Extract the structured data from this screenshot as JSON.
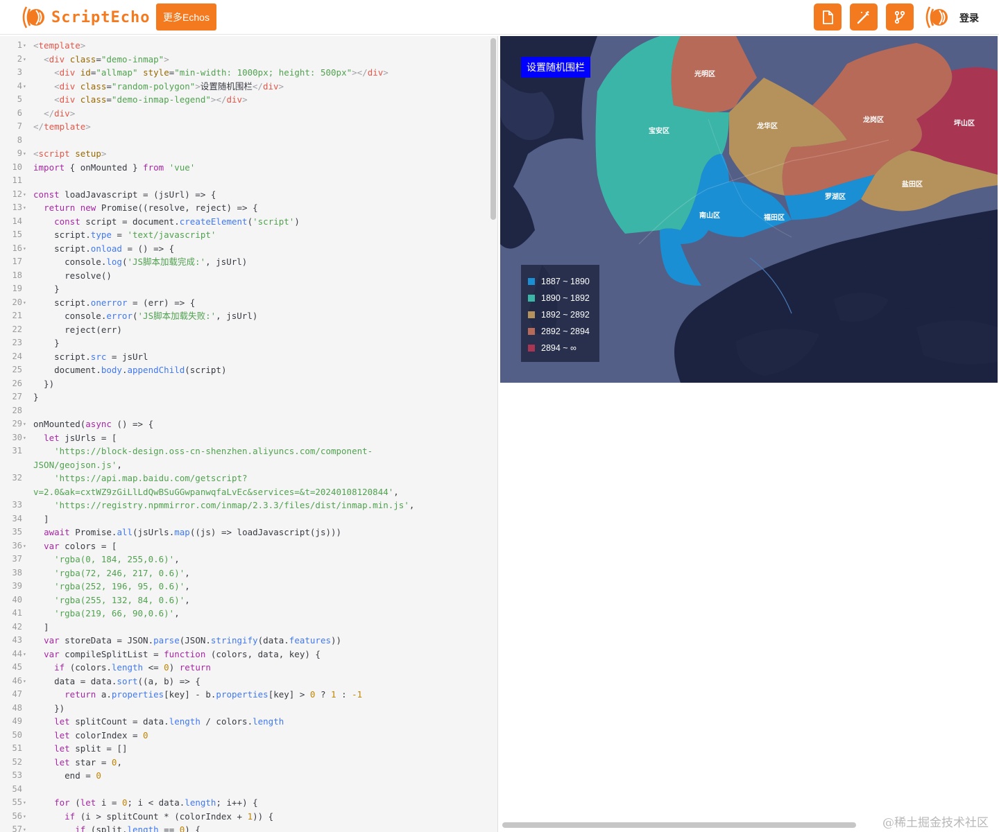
{
  "header": {
    "logo_text": "ScriptEcho",
    "more_button": "更多Echos",
    "login_text": "登录",
    "accent_color": "#f47a20",
    "tools": [
      {
        "name": "file-icon"
      },
      {
        "name": "magic-wand-icon"
      },
      {
        "name": "branch-icon"
      }
    ]
  },
  "editor": {
    "lines": [
      {
        "n": "1",
        "f": true,
        "html": "<span class='c-punc'>&lt;</span><span class='c-tag'>template</span><span class='c-punc'>&gt;</span>"
      },
      {
        "n": "2",
        "f": true,
        "html": "  <span class='c-punc'>&lt;</span><span class='c-tag'>div</span> <span class='c-attr'>class</span>=<span class='c-str'>\"demo-inmap\"</span><span class='c-punc'>&gt;</span>"
      },
      {
        "n": "3",
        "f": false,
        "html": "    <span class='c-punc'>&lt;</span><span class='c-tag'>div</span> <span class='c-attr'>id</span>=<span class='c-str'>\"allmap\"</span> <span class='c-attr'>style</span>=<span class='c-str'>\"min-width: 1000px; height: 500px\"</span><span class='c-punc'>&gt;&lt;/</span><span class='c-tag'>div</span><span class='c-punc'>&gt;</span>"
      },
      {
        "n": "4",
        "f": true,
        "html": "    <span class='c-punc'>&lt;</span><span class='c-tag'>div</span> <span class='c-attr'>class</span>=<span class='c-str'>\"random-polygon\"</span><span class='c-punc'>&gt;</span>设置随机围栏<span class='c-punc'>&lt;/</span><span class='c-tag'>div</span><span class='c-punc'>&gt;</span>"
      },
      {
        "n": "5",
        "f": false,
        "html": "    <span class='c-punc'>&lt;</span><span class='c-tag'>div</span> <span class='c-attr'>class</span>=<span class='c-str'>\"demo-inmap-legend\"</span><span class='c-punc'>&gt;&lt;/</span><span class='c-tag'>div</span><span class='c-punc'>&gt;</span>"
      },
      {
        "n": "6",
        "f": false,
        "html": "  <span class='c-punc'>&lt;/</span><span class='c-tag'>div</span><span class='c-punc'>&gt;</span>"
      },
      {
        "n": "7",
        "f": false,
        "html": "<span class='c-punc'>&lt;/</span><span class='c-tag'>template</span><span class='c-punc'>&gt;</span>"
      },
      {
        "n": "8",
        "f": false,
        "html": ""
      },
      {
        "n": "9",
        "f": true,
        "html": "<span class='c-punc'>&lt;</span><span class='c-tag'>script</span> <span class='c-attr'>setup</span><span class='c-punc'>&gt;</span>"
      },
      {
        "n": "10",
        "f": false,
        "html": "<span class='c-kw'>import</span> { onMounted } <span class='c-kw'>from</span> <span class='c-str'>'vue'</span>"
      },
      {
        "n": "11",
        "f": false,
        "html": ""
      },
      {
        "n": "12",
        "f": true,
        "html": "<span class='c-kw'>const</span> loadJavascript = (jsUrl) =&gt; {"
      },
      {
        "n": "13",
        "f": true,
        "html": "  <span class='c-kw'>return</span> <span class='c-kw'>new</span> Promise((resolve, reject) =&gt; {"
      },
      {
        "n": "14",
        "f": false,
        "html": "    <span class='c-kw'>const</span> script = document.<span class='c-fn'>createElement</span>(<span class='c-str'>'script'</span>)"
      },
      {
        "n": "15",
        "f": false,
        "html": "    script.<span class='c-prop'>type</span> = <span class='c-str'>'text/javascript'</span>"
      },
      {
        "n": "16",
        "f": true,
        "html": "    script.<span class='c-prop'>onload</span> = () =&gt; {"
      },
      {
        "n": "17",
        "f": false,
        "html": "      console.<span class='c-fn'>log</span>(<span class='c-str'>'JS脚本加载完成:'</span>, jsUrl)"
      },
      {
        "n": "18",
        "f": false,
        "html": "      resolve()"
      },
      {
        "n": "19",
        "f": false,
        "html": "    }"
      },
      {
        "n": "20",
        "f": true,
        "html": "    script.<span class='c-prop'>onerror</span> = (err) =&gt; {"
      },
      {
        "n": "21",
        "f": false,
        "html": "      console.<span class='c-fn'>error</span>(<span class='c-str'>'JS脚本加载失败:'</span>, jsUrl)"
      },
      {
        "n": "22",
        "f": false,
        "html": "      reject(err)"
      },
      {
        "n": "23",
        "f": false,
        "html": "    }"
      },
      {
        "n": "24",
        "f": false,
        "html": "    script.<span class='c-prop'>src</span> = jsUrl"
      },
      {
        "n": "25",
        "f": false,
        "html": "    document.<span class='c-prop'>body</span>.<span class='c-fn'>appendChild</span>(script)"
      },
      {
        "n": "26",
        "f": false,
        "html": "  })"
      },
      {
        "n": "27",
        "f": false,
        "html": "}"
      },
      {
        "n": "28",
        "f": false,
        "html": ""
      },
      {
        "n": "29",
        "f": true,
        "html": "onMounted(<span class='c-kw'>async</span> () =&gt; {"
      },
      {
        "n": "30",
        "f": true,
        "html": "  <span class='c-kw'>let</span> jsUrls = ["
      },
      {
        "n": "31",
        "f": false,
        "html": "    <span class='c-str'>'https://block-design.oss-cn-shenzhen.aliyuncs.com/component-</span>"
      },
      {
        "n": "",
        "f": false,
        "html": "<span class='c-str'>JSON/geojson.js'</span>,"
      },
      {
        "n": "32",
        "f": false,
        "html": "    <span class='c-str'>'https://api.map.baidu.com/getscript?</span>"
      },
      {
        "n": "",
        "f": false,
        "html": "<span class='c-str'>v=2.0&amp;ak=cxtWZ9zGiLlLdQwBSuGGwpanwqfaLvEc&amp;services=&amp;t=20240108120844'</span>,"
      },
      {
        "n": "33",
        "f": false,
        "html": "    <span class='c-str'>'https://registry.npmmirror.com/inmap/2.3.3/files/dist/inmap.min.js'</span>,"
      },
      {
        "n": "34",
        "f": false,
        "html": "  ]"
      },
      {
        "n": "35",
        "f": false,
        "html": "  <span class='c-kw'>await</span> Promise.<span class='c-fn'>all</span>(jsUrls.<span class='c-fn'>map</span>((js) =&gt; loadJavascript(js)))"
      },
      {
        "n": "36",
        "f": true,
        "html": "  <span class='c-kw'>var</span> colors = ["
      },
      {
        "n": "37",
        "f": false,
        "html": "    <span class='c-str'>'rgba(0, 184, 255,0.6)'</span>,"
      },
      {
        "n": "38",
        "f": false,
        "html": "    <span class='c-str'>'rgba(72, 246, 217, 0.6)'</span>,"
      },
      {
        "n": "39",
        "f": false,
        "html": "    <span class='c-str'>'rgba(252, 196, 95, 0.6)'</span>,"
      },
      {
        "n": "40",
        "f": false,
        "html": "    <span class='c-str'>'rgba(255, 132, 84, 0.6)'</span>,"
      },
      {
        "n": "41",
        "f": false,
        "html": "    <span class='c-str'>'rgba(219, 66, 90,0.6)'</span>,"
      },
      {
        "n": "42",
        "f": false,
        "html": "  ]"
      },
      {
        "n": "43",
        "f": false,
        "html": "  <span class='c-kw'>var</span> storeData = JSON.<span class='c-fn'>parse</span>(JSON.<span class='c-fn'>stringify</span>(data.<span class='c-prop'>features</span>))"
      },
      {
        "n": "44",
        "f": true,
        "html": "  <span class='c-kw'>var</span> compileSplitList = <span class='c-kw'>function</span> (colors, data, key) {"
      },
      {
        "n": "45",
        "f": false,
        "html": "    <span class='c-kw'>if</span> (colors.<span class='c-prop'>length</span> &lt;= <span class='c-num'>0</span>) <span class='c-kw'>return</span>"
      },
      {
        "n": "46",
        "f": true,
        "html": "    data = data.<span class='c-fn'>sort</span>((a, b) =&gt; {"
      },
      {
        "n": "47",
        "f": false,
        "html": "      <span class='c-kw'>return</span> a.<span class='c-prop'>properties</span>[key] - b.<span class='c-prop'>properties</span>[key] &gt; <span class='c-num'>0</span> ? <span class='c-num'>1</span> : <span class='c-num'>-1</span>"
      },
      {
        "n": "48",
        "f": false,
        "html": "    })"
      },
      {
        "n": "49",
        "f": false,
        "html": "    <span class='c-kw'>let</span> splitCount = data.<span class='c-prop'>length</span> / colors.<span class='c-prop'>length</span>"
      },
      {
        "n": "50",
        "f": false,
        "html": "    <span class='c-kw'>let</span> colorIndex = <span class='c-num'>0</span>"
      },
      {
        "n": "51",
        "f": false,
        "html": "    <span class='c-kw'>let</span> split = []"
      },
      {
        "n": "52",
        "f": false,
        "html": "    <span class='c-kw'>let</span> star = <span class='c-num'>0</span>,"
      },
      {
        "n": "53",
        "f": false,
        "html": "      end = <span class='c-num'>0</span>"
      },
      {
        "n": "54",
        "f": false,
        "html": ""
      },
      {
        "n": "55",
        "f": true,
        "html": "    <span class='c-kw'>for</span> (<span class='c-kw'>let</span> i = <span class='c-num'>0</span>; i &lt; data.<span class='c-prop'>length</span>; i++) {"
      },
      {
        "n": "56",
        "f": true,
        "html": "      <span class='c-kw'>if</span> (i &gt; splitCount * (colorIndex + <span class='c-num'>1</span>)) {"
      },
      {
        "n": "57",
        "f": true,
        "html": "        <span class='c-kw'>if</span> (split.<span class='c-prop'>length</span> == <span class='c-num'>0</span>) {"
      }
    ]
  },
  "map": {
    "title_button": "设置随机围栏",
    "legend": [
      {
        "label": "1887 ~ 1890",
        "color": "#1a8fd4"
      },
      {
        "label": "1890 ~ 1892",
        "color": "#3bb5a8"
      },
      {
        "label": "1892 ~ 2892",
        "color": "#b5915c"
      },
      {
        "label": "2892 ~ 2894",
        "color": "#b86a58"
      },
      {
        "label": "2894 ~ ∞",
        "color": "#a83652"
      }
    ],
    "districts": [
      {
        "name": "光明区"
      },
      {
        "name": "宝安区"
      },
      {
        "name": "龙华区"
      },
      {
        "name": "龙岗区"
      },
      {
        "name": "坪山区"
      },
      {
        "name": "盐田区"
      },
      {
        "name": "罗湖区"
      },
      {
        "name": "福田区"
      },
      {
        "name": "南山区"
      }
    ]
  },
  "watermark": "@稀土掘金技术社区"
}
